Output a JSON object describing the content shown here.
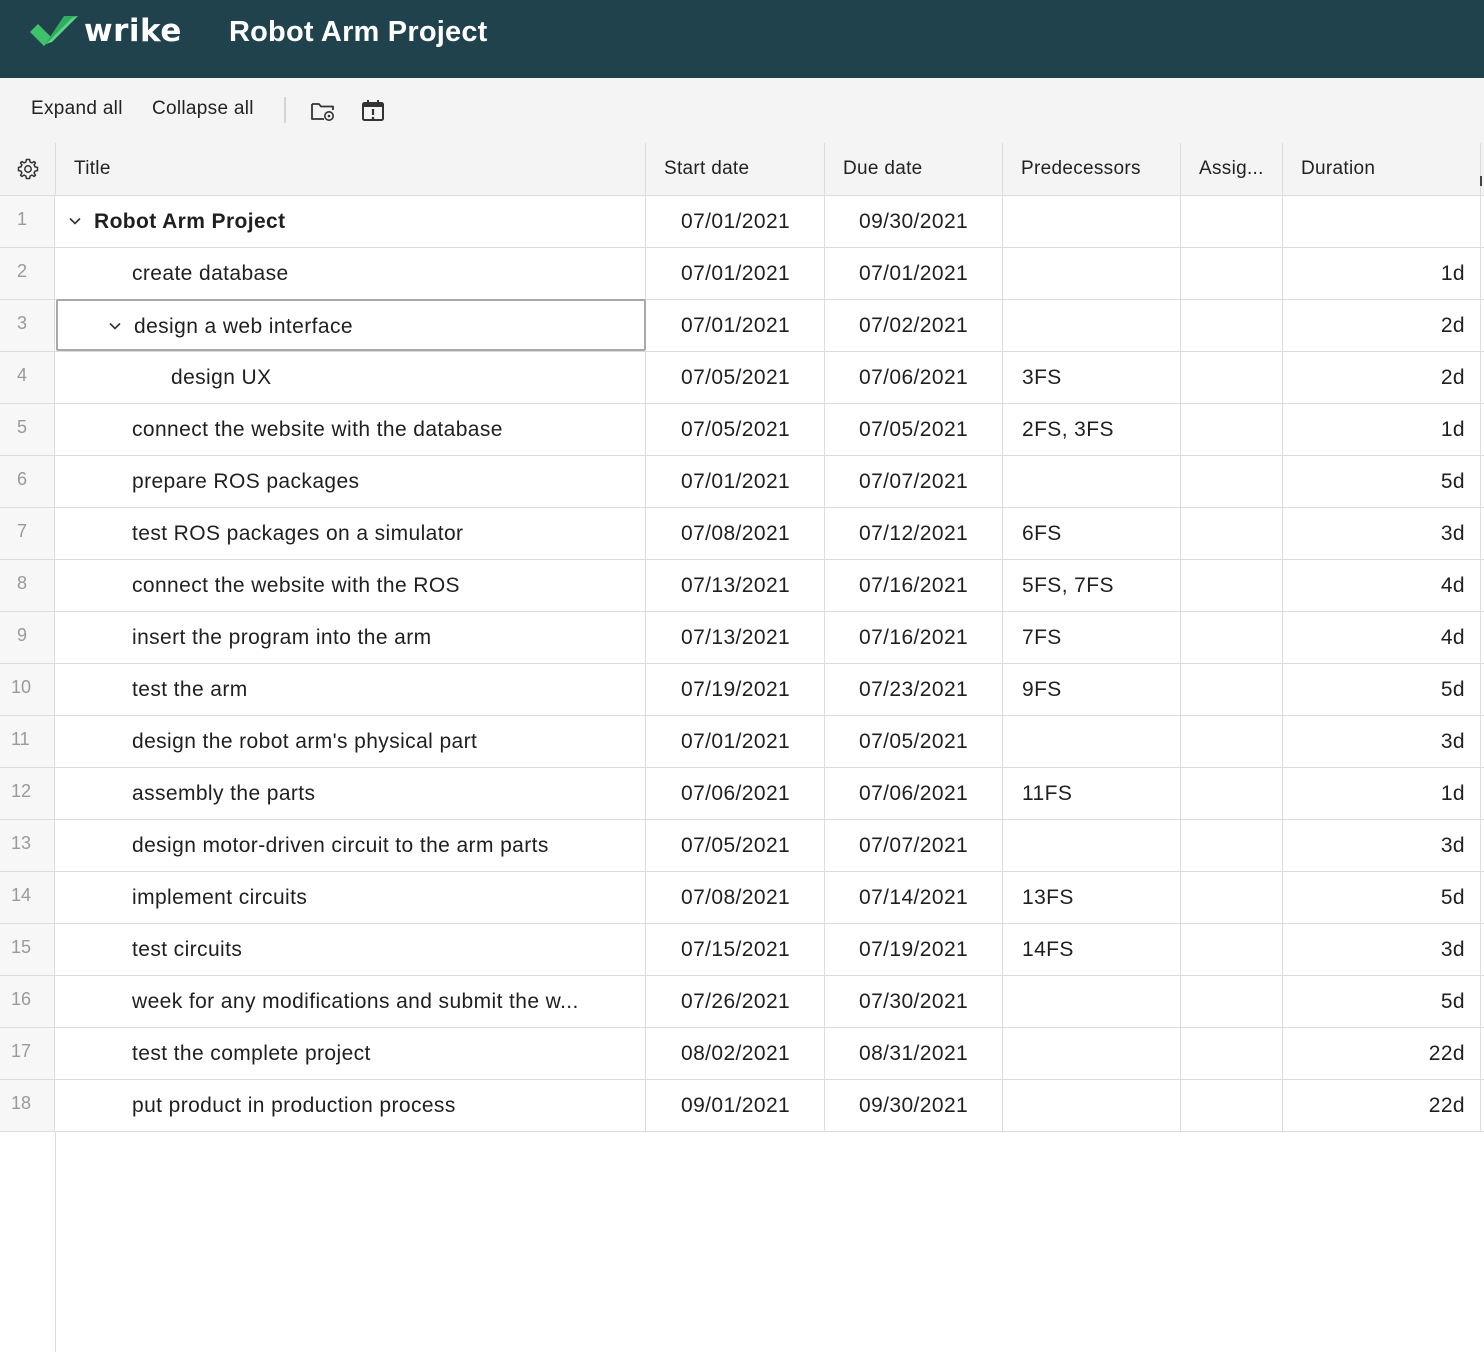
{
  "app": {
    "brand": "wrike",
    "project_title": "Robot Arm Project",
    "colors": {
      "topbar": "#1f424d",
      "logo_check": "#3fc26b"
    }
  },
  "toolbar": {
    "expand_label": "Expand all",
    "collapse_label": "Collapse all",
    "icons": [
      "folder-settings-icon",
      "calendar-alert-icon"
    ]
  },
  "columns": {
    "settings_icon": "gear-icon",
    "title": "Title",
    "start": "Start date",
    "due": "Due date",
    "pred": "Predecessors",
    "assign": "Assig...",
    "duration": "Duration"
  },
  "rows": [
    {
      "num": "1",
      "title": "Robot Arm Project",
      "start": "07/01/2021",
      "due": "09/30/2021",
      "pred": "",
      "dur": ""
    },
    {
      "num": "2",
      "title": "create database",
      "start": "07/01/2021",
      "due": "07/01/2021",
      "pred": "",
      "dur": "1d"
    },
    {
      "num": "3",
      "title": "design a web interface",
      "start": "07/01/2021",
      "due": "07/02/2021",
      "pred": "",
      "dur": "2d"
    },
    {
      "num": "4",
      "title": "design UX",
      "start": "07/05/2021",
      "due": "07/06/2021",
      "pred": "3FS",
      "dur": "2d"
    },
    {
      "num": "5",
      "title": "connect the website with the database",
      "start": "07/05/2021",
      "due": "07/05/2021",
      "pred": "2FS, 3FS",
      "dur": "1d"
    },
    {
      "num": "6",
      "title": "prepare ROS packages",
      "start": "07/01/2021",
      "due": "07/07/2021",
      "pred": "",
      "dur": "5d"
    },
    {
      "num": "7",
      "title": "test ROS packages on a simulator",
      "start": "07/08/2021",
      "due": "07/12/2021",
      "pred": "6FS",
      "dur": "3d"
    },
    {
      "num": "8",
      "title": "connect the website with the ROS",
      "start": "07/13/2021",
      "due": "07/16/2021",
      "pred": "5FS, 7FS",
      "dur": "4d"
    },
    {
      "num": "9",
      "title": "insert the program into the arm",
      "start": "07/13/2021",
      "due": "07/16/2021",
      "pred": "7FS",
      "dur": "4d"
    },
    {
      "num": "10",
      "title": "test the arm",
      "start": "07/19/2021",
      "due": "07/23/2021",
      "pred": "9FS",
      "dur": "5d"
    },
    {
      "num": "11",
      "title": "design the robot arm's physical part",
      "start": "07/01/2021",
      "due": "07/05/2021",
      "pred": "",
      "dur": "3d"
    },
    {
      "num": "12",
      "title": "assembly the parts",
      "start": "07/06/2021",
      "due": "07/06/2021",
      "pred": "11FS",
      "dur": "1d"
    },
    {
      "num": "13",
      "title": "design motor-driven circuit to the arm parts",
      "start": "07/05/2021",
      "due": "07/07/2021",
      "pred": "",
      "dur": "3d"
    },
    {
      "num": "14",
      "title": "implement circuits",
      "start": "07/08/2021",
      "due": "07/14/2021",
      "pred": "13FS",
      "dur": "5d"
    },
    {
      "num": "15",
      "title": "test circuits",
      "start": "07/15/2021",
      "due": "07/19/2021",
      "pred": "14FS",
      "dur": "3d"
    },
    {
      "num": "16",
      "title": "week for any modifications and submit the w...",
      "start": "07/26/2021",
      "due": "07/30/2021",
      "pred": "",
      "dur": "5d"
    },
    {
      "num": "17",
      "title": "test the complete project",
      "start": "08/02/2021",
      "due": "08/31/2021",
      "pred": "",
      "dur": "22d"
    },
    {
      "num": "18",
      "title": "put product in production process",
      "start": "09/01/2021",
      "due": "09/30/2021",
      "pred": "",
      "dur": "22d"
    }
  ]
}
